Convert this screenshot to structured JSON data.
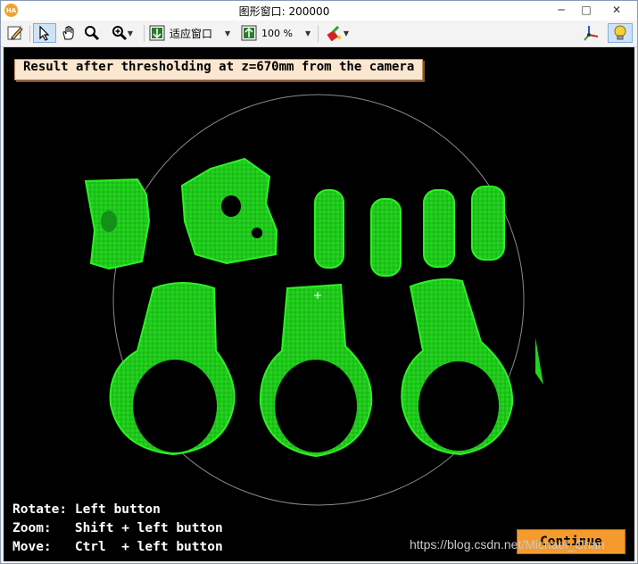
{
  "window": {
    "app_icon_text": "HA",
    "title": "图形窗口: 200000",
    "minimize": "─",
    "maximize": "□",
    "close": "✕"
  },
  "toolbar": {
    "fit_window_label": "适应窗口",
    "zoom_value": "100 %"
  },
  "viewport": {
    "result_label": "Result after thresholding at z=670mm from the camera",
    "help_rotate": "Rotate: Left button",
    "help_zoom": "Zoom:   Shift + left button",
    "help_move": "Move:   Ctrl  + left button",
    "continue_label": "Continue",
    "watermark": "https://blog.csdn.net/Michael_Chan",
    "object_color": "#22d41e",
    "background_color": "#000000"
  }
}
